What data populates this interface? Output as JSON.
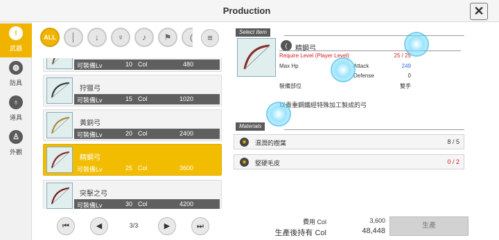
{
  "header": {
    "title": "Production",
    "close": "✕"
  },
  "sidebar": [
    {
      "label": "武器",
      "icon": "weapon-icon",
      "glyph": "!",
      "active": true
    },
    {
      "label": "防具",
      "icon": "armor-icon",
      "glyph": "◍",
      "active": false
    },
    {
      "label": "道具",
      "icon": "potion-icon",
      "glyph": "♁",
      "active": false
    },
    {
      "label": "外觀",
      "icon": "costume-icon",
      "glyph": "♙",
      "active": false
    }
  ],
  "filters": [
    {
      "label": "ALL",
      "icon": "all-filter-icon"
    },
    {
      "label": "│",
      "icon": "one-handed-sword-icon"
    },
    {
      "label": "↓",
      "icon": "rapier-icon"
    },
    {
      "label": "♆",
      "icon": "mace-icon"
    },
    {
      "label": "♪",
      "icon": "dagger-icon"
    },
    {
      "label": "⚑",
      "icon": "axe-icon"
    },
    {
      "label": "(",
      "icon": "bow-icon"
    }
  ],
  "sort_icon": "≡",
  "list": {
    "items": [
      {
        "name": "",
        "lv_label": "可裝備Lv",
        "lv": "10",
        "col_label": "Col",
        "col": "480",
        "selected": false
      },
      {
        "name": "狩獵弓",
        "lv_label": "可裝備Lv",
        "lv": "15",
        "col_label": "Col",
        "col": "1020",
        "selected": false
      },
      {
        "name": "黃銅弓",
        "lv_label": "可裝備Lv",
        "lv": "20",
        "col_label": "Col",
        "col": "2400",
        "selected": false
      },
      {
        "name": "精鋼弓",
        "lv_label": "可裝備Lv",
        "lv": "25",
        "col_label": "Col",
        "col": "3600",
        "selected": true
      },
      {
        "name": "突擊之弓",
        "lv_label": "可裝備Lv",
        "lv": "30",
        "col_label": "Col",
        "col": "4200",
        "selected": false
      }
    ]
  },
  "pager": {
    "first": "⏮",
    "prev": "◀",
    "page": "3/3",
    "next": "▶",
    "last": "⏭"
  },
  "detail": {
    "section_label": "Select Item",
    "name": "精鋼弓",
    "stats": [
      {
        "label": "Require Level (Player Level)",
        "value": "25 / 25",
        "style": "req"
      },
      {
        "label": "Max Hp",
        "value": "",
        "style": ""
      },
      {
        "label": "Attack",
        "value": "249",
        "style": "blue"
      },
      {
        "label": "Defense",
        "value": "0",
        "style": ""
      },
      {
        "label": "裝備部位",
        "value": "雙手",
        "style": ""
      }
    ],
    "description": "以貴重鋼鐵經特殊加工製成的弓"
  },
  "materials": {
    "section_label": "Materials",
    "items": [
      {
        "name": "濕潤的樹葉",
        "qty": "8 /  5",
        "short": false
      },
      {
        "name": "堅硬毛皮",
        "qty": "0 /  2",
        "short": true
      }
    ]
  },
  "costs": [
    {
      "label": "費用 Col",
      "value": "3,600"
    },
    {
      "label": "生產後持有 Col",
      "value": "48,448"
    }
  ],
  "produce_label": "生產"
}
